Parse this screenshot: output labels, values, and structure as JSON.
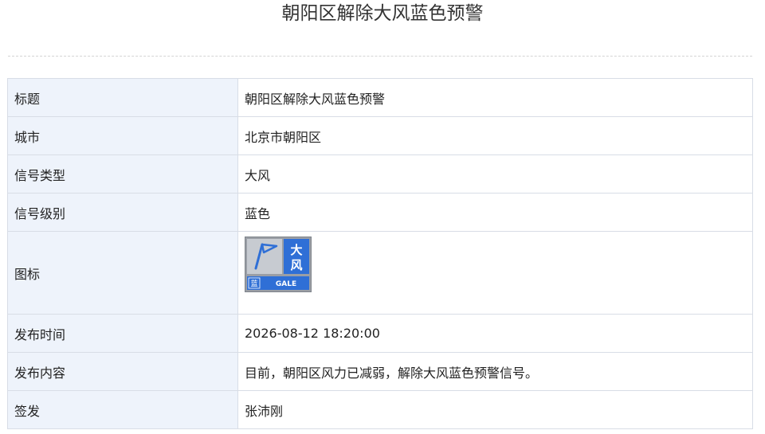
{
  "page": {
    "title": "朝阳区解除大风蓝色预警"
  },
  "table": {
    "rows": [
      {
        "label": "标题",
        "value": "朝阳区解除大风蓝色预警"
      },
      {
        "label": "城市",
        "value": "北京市朝阳区"
      },
      {
        "label": "信号类型",
        "value": "大风"
      },
      {
        "label": "信号级别",
        "value": "蓝色"
      },
      {
        "label": "图标",
        "value": ""
      },
      {
        "label": "发布时间",
        "value": "2026-08-12 18:20:00"
      },
      {
        "label": "发布内容",
        "value": "目前，朝阳区风力已减弱，解除大风蓝色预警信号。"
      },
      {
        "label": "签发",
        "value": "张沛刚"
      }
    ]
  },
  "signal_icon": {
    "name": "gale-blue-warning-icon",
    "title_chars": "大风",
    "level_char": "蓝",
    "code": "GALE",
    "colors": {
      "blue": "#2f6fd6",
      "gray": "#9a9ea5",
      "panel": "#c7cbd1",
      "white": "#ffffff"
    }
  }
}
